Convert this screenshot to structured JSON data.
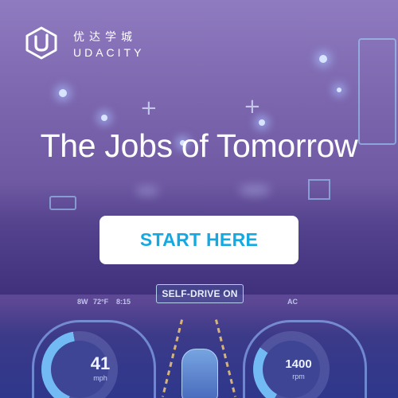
{
  "brand": {
    "chinese_name": "优达学城",
    "english_name": "UDACITY",
    "logo_icon": "udacity-u-logo-icon"
  },
  "headline": "The Jobs of Tomorrow",
  "cta": {
    "label": "START HERE",
    "text_color": "#14a9e0",
    "background": "#ffffff"
  },
  "dashboard": {
    "mode_label": "SELF-DRIVE ON",
    "status_left": "8W",
    "temperature": "72°F",
    "time": "8:15",
    "status_right": "AC",
    "speed": {
      "value": "41",
      "unit": "mph"
    },
    "rpm": {
      "value": "1400",
      "unit": "rpm"
    }
  },
  "colors": {
    "background_purple": "#7a64ac",
    "accent_blue": "#14a9e0",
    "text_white": "#ffffff"
  }
}
